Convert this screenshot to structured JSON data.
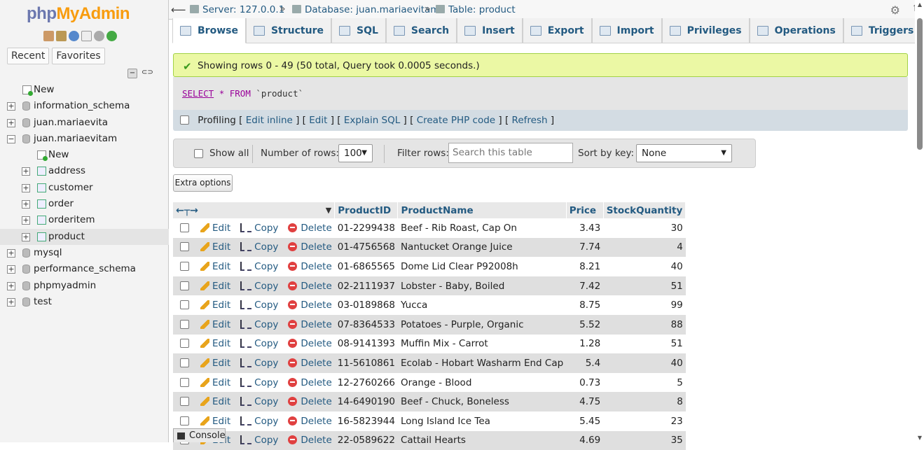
{
  "nav": {
    "logo_part1": "php",
    "logo_part2": "MyAdmin",
    "recent": "Recent",
    "favorites": "Favorites",
    "tree": [
      {
        "label": "New",
        "type": "new",
        "level": 0
      },
      {
        "label": "information_schema",
        "type": "db",
        "level": 0
      },
      {
        "label": "juan.mariaevita",
        "type": "db",
        "level": 0
      },
      {
        "label": "juan.mariaevitam",
        "type": "db",
        "level": 0,
        "expanded": true
      },
      {
        "label": "New",
        "type": "new",
        "level": 1
      },
      {
        "label": "address",
        "type": "table",
        "level": 1
      },
      {
        "label": "customer",
        "type": "table",
        "level": 1
      },
      {
        "label": "order",
        "type": "table",
        "level": 1
      },
      {
        "label": "orderitem",
        "type": "table",
        "level": 1
      },
      {
        "label": "product",
        "type": "table",
        "level": 1,
        "selected": true
      },
      {
        "label": "mysql",
        "type": "db",
        "level": 0
      },
      {
        "label": "performance_schema",
        "type": "db",
        "level": 0
      },
      {
        "label": "phpmyadmin",
        "type": "db",
        "level": 0
      },
      {
        "label": "test",
        "type": "db",
        "level": 0
      }
    ]
  },
  "breadcrumb": {
    "server": "Server: 127.0.0.1",
    "database": "Database: juan.mariaevitam",
    "table": "Table: product"
  },
  "tabs": [
    "Browse",
    "Structure",
    "SQL",
    "Search",
    "Insert",
    "Export",
    "Import",
    "Privileges",
    "Operations",
    "Triggers"
  ],
  "success_message": "Showing rows 0 - 49 (50 total, Query took 0.0005 seconds.)",
  "sql": {
    "select": "SELECT",
    "star": "*",
    "from": "FROM",
    "table": "`product`"
  },
  "profiling": {
    "label": "Profiling",
    "links": [
      "Edit inline",
      "Edit",
      "Explain SQL",
      "Create PHP code",
      "Refresh"
    ]
  },
  "controls": {
    "show_all": "Show all",
    "number_of_rows_label": "Number of rows:",
    "number_of_rows_value": "100",
    "filter_rows_label": "Filter rows:",
    "filter_placeholder": "Search this table",
    "sort_by_key_label": "Sort by key:",
    "sort_by_key_value": "None",
    "extra_options": "Extra options"
  },
  "table": {
    "columns": [
      "ProductID",
      "ProductName",
      "Price",
      "StockQuantity"
    ],
    "actions": {
      "edit": "Edit",
      "copy": "Copy",
      "delete": "Delete"
    },
    "rows": [
      [
        "01-2299438",
        "Beef - Rib Roast, Cap On",
        "3.43",
        "30"
      ],
      [
        "01-4756568",
        "Nantucket Orange Juice",
        "7.74",
        "4"
      ],
      [
        "01-6865565",
        "Dome Lid Clear P92008h",
        "8.21",
        "40"
      ],
      [
        "02-2111937",
        "Lobster - Baby, Boiled",
        "7.42",
        "51"
      ],
      [
        "03-0189868",
        "Yucca",
        "8.75",
        "99"
      ],
      [
        "07-8364533",
        "Potatoes - Purple, Organic",
        "5.52",
        "88"
      ],
      [
        "08-9141393",
        "Muffin Mix - Carrot",
        "1.28",
        "51"
      ],
      [
        "11-5610861",
        "Ecolab - Hobart Washarm End Cap",
        "5.4",
        "40"
      ],
      [
        "12-2760266",
        "Orange - Blood",
        "0.73",
        "5"
      ],
      [
        "14-6490190",
        "Beef - Chuck, Boneless",
        "4.75",
        "8"
      ],
      [
        "16-5823944",
        "Long Island Ice Tea",
        "5.45",
        "23"
      ],
      [
        "22-0589622",
        "Cattail Hearts",
        "4.69",
        "35"
      ]
    ]
  },
  "console_label": "Console"
}
